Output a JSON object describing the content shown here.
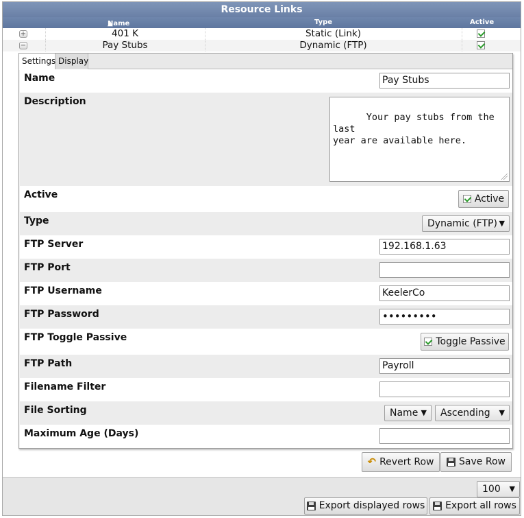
{
  "panel": {
    "title": "Resource Links",
    "columns": {
      "name": "Name",
      "type": "Type",
      "active": "Active"
    },
    "rows": [
      {
        "name": "401 K",
        "type": "Static (Link)",
        "active": true,
        "expander": "+"
      },
      {
        "name": "Pay Stubs",
        "type": "Dynamic (FTP)",
        "active": true,
        "expander": "−"
      }
    ]
  },
  "tabs": {
    "settings": "Settings",
    "display": "Display"
  },
  "form": {
    "name_label": "Name",
    "name_value": "Pay Stubs",
    "description_label": "Description",
    "description_value": "Your pay stubs from the last\nyear are available here.",
    "active_label": "Active",
    "active_toggle": "Active",
    "type_label": "Type",
    "type_value": "Dynamic (FTP)",
    "ftp_server_label": "FTP Server",
    "ftp_server_value": "192.168.1.63",
    "ftp_port_label": "FTP Port",
    "ftp_port_value": "",
    "ftp_username_label": "FTP Username",
    "ftp_username_value": "KeelerCo",
    "ftp_password_label": "FTP Password",
    "ftp_password_value": "•••••••••",
    "ftp_passive_label": "FTP Toggle Passive",
    "ftp_passive_toggle": "Toggle Passive",
    "ftp_path_label": "FTP Path",
    "ftp_path_value": "Payroll",
    "filename_filter_label": "Filename Filter",
    "filename_filter_value": "",
    "file_sorting_label": "File Sorting",
    "file_sorting_field": "Name",
    "file_sorting_order": "Ascending",
    "max_age_label": "Maximum Age (Days)",
    "max_age_value": ""
  },
  "actions": {
    "revert": "Revert Row",
    "save": "Save Row"
  },
  "footer": {
    "page_size": "100",
    "export_displayed": "Export displayed rows",
    "export_all": "Export all rows"
  },
  "colors": {
    "header": "#6f86ac",
    "check": "#2a9a2a"
  }
}
